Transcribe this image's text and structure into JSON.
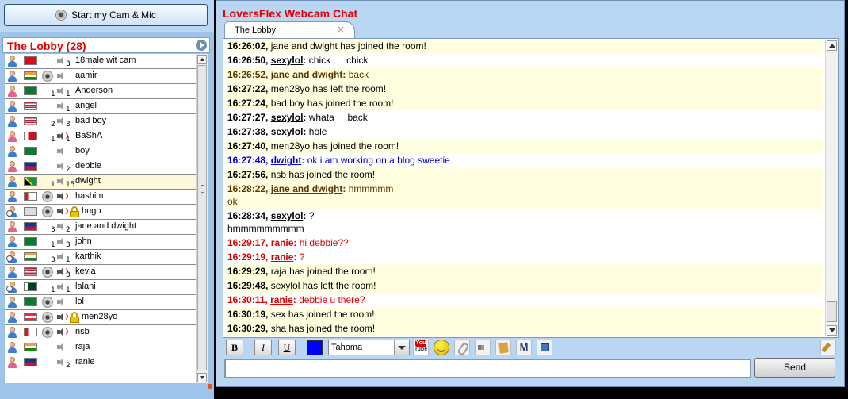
{
  "camera_button": {
    "label": "Start my Cam & Mic",
    "icon": "webcam-icon"
  },
  "lobby": {
    "title": "The Lobby (28)",
    "next_icon": "play-arrow-icon",
    "users": [
      {
        "name": "18male wit cam",
        "gender": "m",
        "flag": "turkey",
        "cam": false,
        "mic": false,
        "lock": false,
        "n1": "",
        "n2": "3"
      },
      {
        "name": "aamir",
        "gender": "m",
        "flag": "india",
        "cam": true,
        "mic": false,
        "lock": false,
        "n1": "",
        "n2": ""
      },
      {
        "name": "Anderson",
        "gender": "f",
        "flag": "saudi",
        "cam": false,
        "mic": false,
        "lock": false,
        "n1": "1",
        "n2": "1"
      },
      {
        "name": "angel",
        "gender": "m",
        "flag": "usa",
        "cam": false,
        "mic": false,
        "lock": false,
        "n1": "",
        "n2": "1"
      },
      {
        "name": "bad boy",
        "gender": "m",
        "flag": "usa",
        "cam": false,
        "mic": false,
        "lock": false,
        "n1": "2",
        "n2": "3"
      },
      {
        "name": "BaShA",
        "gender": "f",
        "flag": "bahrain",
        "cam": false,
        "mic": true,
        "lock": false,
        "n1": "1",
        "n2": "1"
      },
      {
        "name": "boy",
        "gender": "m",
        "flag": "saudi",
        "cam": false,
        "mic": false,
        "lock": false,
        "n1": "",
        "n2": ""
      },
      {
        "name": "debbie",
        "gender": "f",
        "flag": "philippines",
        "cam": false,
        "mic": false,
        "lock": false,
        "n1": "",
        "n2": "2"
      },
      {
        "name": "dwight",
        "gender": "m",
        "flag": "jamaica",
        "cam": false,
        "mic": false,
        "lock": false,
        "n1": "1",
        "n2": "15",
        "selected": true
      },
      {
        "name": "hashim",
        "gender": "m",
        "flag": "oman",
        "cam": true,
        "mic": true,
        "lock": false,
        "n1": "",
        "n2": ""
      },
      {
        "name": "hugo",
        "gender": "w",
        "flag": "generic",
        "cam": true,
        "mic": true,
        "lock": true,
        "n1": "",
        "n2": ""
      },
      {
        "name": "jane and dwight",
        "gender": "f",
        "flag": "philippines",
        "cam": false,
        "mic": false,
        "lock": false,
        "n1": "3",
        "n2": "2"
      },
      {
        "name": "john",
        "gender": "m",
        "flag": "saudi",
        "cam": false,
        "mic": false,
        "lock": false,
        "n1": "1",
        "n2": "3"
      },
      {
        "name": "karthik",
        "gender": "w",
        "flag": "india",
        "cam": false,
        "mic": false,
        "lock": false,
        "n1": "3",
        "n2": "1"
      },
      {
        "name": "kevia",
        "gender": "m",
        "flag": "usa",
        "cam": true,
        "mic": true,
        "lock": false,
        "n1": "",
        "n2": "3"
      },
      {
        "name": "lalani",
        "gender": "w",
        "flag": "pakistan",
        "cam": false,
        "mic": false,
        "lock": false,
        "n1": "1",
        "n2": "1"
      },
      {
        "name": "lol",
        "gender": "m",
        "flag": "saudi",
        "cam": true,
        "mic": false,
        "lock": false,
        "n1": "",
        "n2": ""
      },
      {
        "name": "men28yo",
        "gender": "m",
        "flag": "austria",
        "cam": true,
        "mic": true,
        "lock": true,
        "n1": "",
        "n2": ""
      },
      {
        "name": "nsb",
        "gender": "m",
        "flag": "oman",
        "cam": true,
        "mic": true,
        "lock": false,
        "n1": "",
        "n2": ""
      },
      {
        "name": "raja",
        "gender": "m",
        "flag": "india",
        "cam": false,
        "mic": false,
        "lock": false,
        "n1": "",
        "n2": ""
      },
      {
        "name": "ranie",
        "gender": "f",
        "flag": "philippines",
        "cam": false,
        "mic": false,
        "lock": false,
        "n1": "",
        "n2": "2"
      }
    ]
  },
  "app": {
    "title": "LoversFlex Webcam Chat"
  },
  "tabs": [
    {
      "label": "The Lobby",
      "close": "×"
    }
  ],
  "messages": [
    {
      "time": "16:26:02,",
      "user": "",
      "text": "jane and dwight has joined the room!",
      "color": "black",
      "yellow": true
    },
    {
      "time": "16:26:50,",
      "user": "sexylol",
      "text": "chick      chick",
      "color": "black",
      "yellow": false
    },
    {
      "time": "16:26:52,",
      "user": "jane and dwight",
      "text": "back",
      "color": "brown",
      "yellow": true
    },
    {
      "time": "16:27:22,",
      "user": "",
      "text": "men28yo has left the room!",
      "color": "black",
      "yellow": true
    },
    {
      "time": "16:27:24,",
      "user": "",
      "text": "bad boy has joined the room!",
      "color": "black",
      "yellow": true
    },
    {
      "time": "16:27:27,",
      "user": "sexylol",
      "text": "whata     back",
      "color": "black",
      "yellow": false
    },
    {
      "time": "16:27:38,",
      "user": "sexylol",
      "text": "hole",
      "color": "black",
      "yellow": false
    },
    {
      "time": "16:27:40,",
      "user": "",
      "text": "men28yo has joined the room!",
      "color": "black",
      "yellow": true
    },
    {
      "time": "16:27:48,",
      "user": "dwight",
      "text": "ok i am working on a blog sweetie",
      "color": "blue",
      "yellow": false
    },
    {
      "time": "16:27:56,",
      "user": "",
      "text": "nsb has joined the room!",
      "color": "black",
      "yellow": true
    },
    {
      "time": "16:28:22,",
      "user": "jane and dwight",
      "text": "hmmmmm",
      "extra": "ok",
      "color": "brown",
      "yellow": true
    },
    {
      "time": "16:28:34,",
      "user": "sexylol",
      "text": "?",
      "extra": "hmmmmmmmmm",
      "color": "black",
      "yellow": false
    },
    {
      "time": "16:29:17,",
      "user": "ranie",
      "text": "hi debbie??",
      "color": "red",
      "yellow": false
    },
    {
      "time": "16:29:19,",
      "user": "ranie",
      "text": "?",
      "color": "red",
      "yellow": false
    },
    {
      "time": "16:29:29,",
      "user": "",
      "text": "raja has joined the room!",
      "color": "black",
      "yellow": true
    },
    {
      "time": "16:29:48,",
      "user": "",
      "text": "sexylol has left the room!",
      "color": "black",
      "yellow": true
    },
    {
      "time": "16:30:11,",
      "user": "ranie",
      "text": "debbie u there?",
      "color": "red",
      "yellow": false
    },
    {
      "time": "16:30:19,",
      "user": "",
      "text": "sex has joined the room!",
      "color": "black",
      "yellow": true
    },
    {
      "time": "16:30:29,",
      "user": "",
      "text": "sha has joined the room!",
      "color": "black",
      "yellow": true
    }
  ],
  "toolbar": {
    "bold": "B",
    "italic": "I",
    "underline": "U",
    "color": "#0000ff",
    "font": "Tahoma",
    "youtube": {
      "top": "You",
      "bottom": "Tube"
    },
    "icons": [
      "emoticon-icon",
      "attachment-icon",
      "sound-icon",
      "notes-icon",
      "mail-icon",
      "window-icon",
      "clear-icon"
    ],
    "mail_glyph": "M"
  },
  "input": {
    "value": "",
    "placeholder": ""
  },
  "send_button": {
    "label": "Send"
  }
}
